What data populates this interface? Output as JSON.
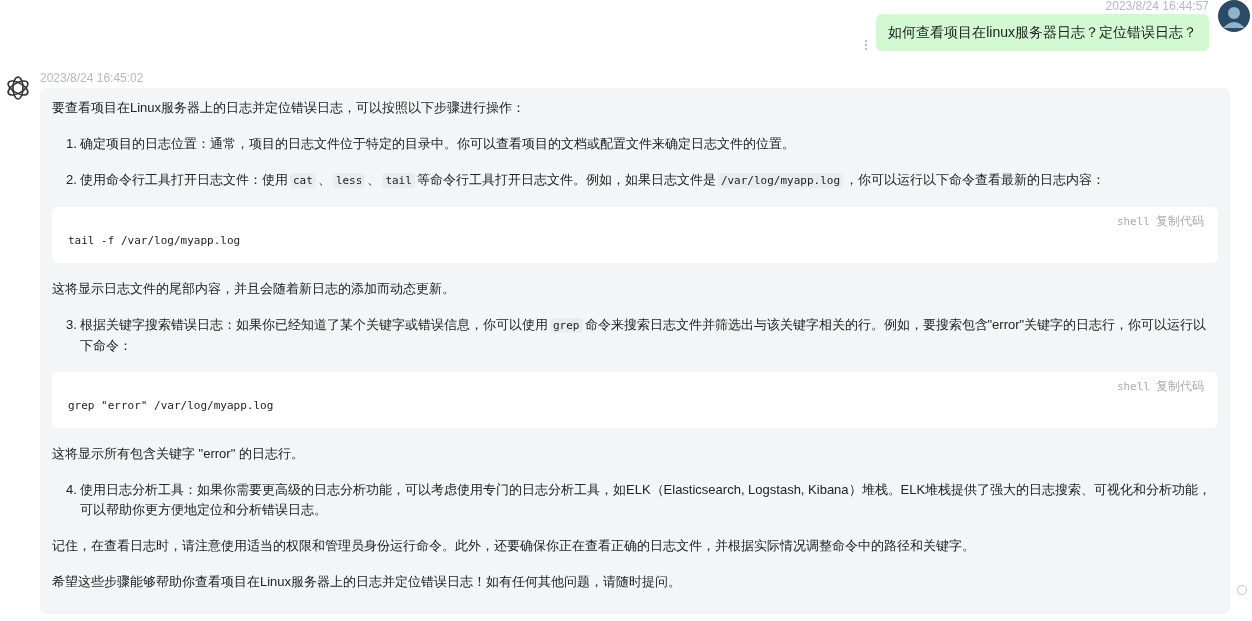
{
  "user_message": {
    "time": "2023/8/24 16:44:57",
    "text": "如何查看项目在linux服务器日志？定位错误日志？"
  },
  "bot_message": {
    "time": "2023/8/24 16:45:02",
    "blocks": [
      {
        "kind": "paragraph",
        "parts": [
          {
            "kind": "text",
            "text": "要查看项目在Linux服务器上的日志并定位错误日志，可以按照以下步骤进行操作："
          }
        ]
      },
      {
        "kind": "list-item",
        "number": "1.",
        "parts": [
          {
            "kind": "text",
            "text": "确定项目的日志位置：通常，项目的日志文件位于特定的目录中。你可以查看项目的文档或配置文件来确定日志文件的位置。"
          }
        ]
      },
      {
        "kind": "list-item",
        "number": "2.",
        "parts": [
          {
            "kind": "text",
            "text": "使用命令行工具打开日志文件：使用"
          },
          {
            "kind": "code",
            "text": "cat"
          },
          {
            "kind": "text",
            "text": "、"
          },
          {
            "kind": "code",
            "text": "less"
          },
          {
            "kind": "text",
            "text": "、"
          },
          {
            "kind": "code",
            "text": "tail"
          },
          {
            "kind": "text",
            "text": "等命令行工具打开日志文件。例如，如果日志文件是"
          },
          {
            "kind": "code",
            "text": "/var/log/myapp.log"
          },
          {
            "kind": "text",
            "text": "，你可以运行以下命令查看最新的日志内容："
          }
        ]
      },
      {
        "kind": "code",
        "language": "shell",
        "copy": "复制代码",
        "code": "tail -f /var/log/myapp.log"
      },
      {
        "kind": "paragraph",
        "parts": [
          {
            "kind": "text",
            "text": "这将显示日志文件的尾部内容，并且会随着新日志的添加而动态更新。"
          }
        ]
      },
      {
        "kind": "list-item",
        "number": "3.",
        "parts": [
          {
            "kind": "text",
            "text": "根据关键字搜索错误日志：如果你已经知道了某个关键字或错误信息，你可以使用"
          },
          {
            "kind": "code",
            "text": "grep"
          },
          {
            "kind": "text",
            "text": "命令来搜索日志文件并筛选出与该关键字相关的行。例如，要搜索包含\"error\"关键字的日志行，你可以运行以下命令："
          }
        ]
      },
      {
        "kind": "code",
        "language": "shell",
        "copy": "复制代码",
        "code": "grep \"error\" /var/log/myapp.log"
      },
      {
        "kind": "paragraph",
        "parts": [
          {
            "kind": "text",
            "text": "这将显示所有包含关键字 \"error\" 的日志行。"
          }
        ]
      },
      {
        "kind": "list-item",
        "number": "4.",
        "parts": [
          {
            "kind": "text",
            "text": "使用日志分析工具：如果你需要更高级的日志分析功能，可以考虑使用专门的日志分析工具，如ELK（Elasticsearch, Logstash, Kibana）堆栈。ELK堆栈提供了强大的日志搜索、可视化和分析功能，可以帮助你更方便地定位和分析错误日志。"
          }
        ]
      },
      {
        "kind": "paragraph",
        "parts": [
          {
            "kind": "text",
            "text": "记住，在查看日志时，请注意使用适当的权限和管理员身份运行命令。此外，还要确保你正在查看正确的日志文件，并根据实际情况调整命令中的路径和关键字。"
          }
        ]
      },
      {
        "kind": "paragraph",
        "parts": [
          {
            "kind": "text",
            "text": "希望这些步骤能够帮助你查看项目在Linux服务器上的日志并定位错误日志！如有任何其他问题，请随时提问。"
          }
        ]
      }
    ]
  }
}
